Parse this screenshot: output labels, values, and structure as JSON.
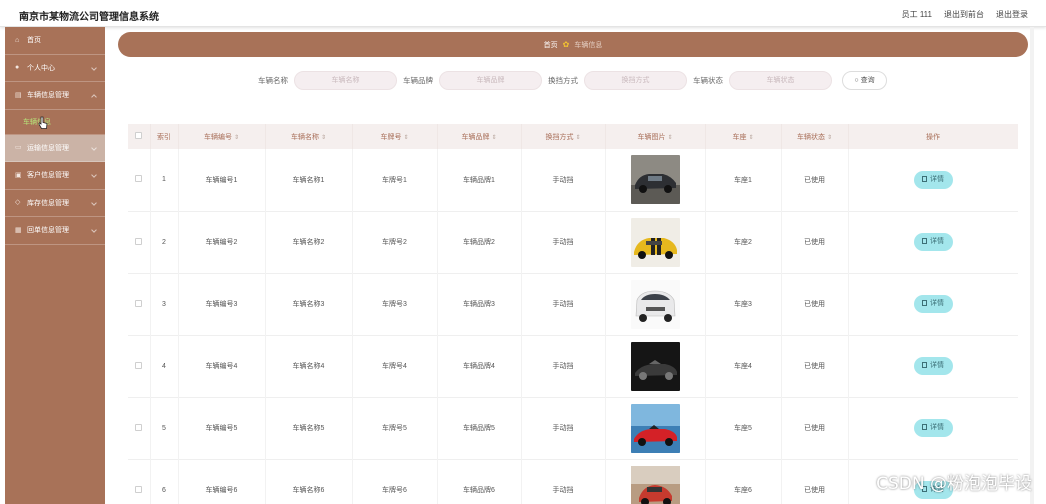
{
  "app": {
    "title": "南京市某物流公司管理信息系统"
  },
  "header": {
    "user": "员工 111",
    "back_front": "退出到前台",
    "logout": "退出登录"
  },
  "sidebar": {
    "items": [
      {
        "label": "首页",
        "icon": "home-icon"
      },
      {
        "label": "个人中心",
        "icon": "user-icon"
      },
      {
        "label": "车辆信息管理",
        "icon": "car-icon"
      },
      {
        "label": "车辆信息",
        "icon": ""
      },
      {
        "label": "运输信息管理",
        "icon": "truck-icon"
      },
      {
        "label": "客户信息管理",
        "icon": "customer-icon"
      },
      {
        "label": "库存信息管理",
        "icon": "warehouse-icon"
      },
      {
        "label": "回单信息管理",
        "icon": "receipt-icon"
      }
    ]
  },
  "breadcrumb": {
    "home": "首页",
    "current": "车辆信息"
  },
  "search": {
    "fields": [
      {
        "label": "车辆名称",
        "placeholder": "车辆名称"
      },
      {
        "label": "车辆品牌",
        "placeholder": "车辆品牌"
      },
      {
        "label": "换挡方式",
        "placeholder": "换挡方式"
      },
      {
        "label": "车辆状态",
        "placeholder": "车辆状态"
      }
    ],
    "button": "查询"
  },
  "table": {
    "columns": [
      "索引",
      "车辆编号",
      "车辆名称",
      "车牌号",
      "车辆品牌",
      "换挡方式",
      "车辆图片",
      "车座",
      "车辆状态",
      "操作"
    ],
    "detail_label": "详情",
    "rows": [
      {
        "index": "1",
        "code": "车辆编号1",
        "name": "车辆名称1",
        "plate": "车牌号1",
        "brand": "车辆品牌1",
        "gear": "手动挡",
        "seat": "车座1",
        "status": "已使用",
        "img": "dark-sports-car"
      },
      {
        "index": "2",
        "code": "车辆编号2",
        "name": "车辆名称2",
        "plate": "车牌号2",
        "brand": "车辆品牌2",
        "gear": "手动挡",
        "seat": "车座2",
        "status": "已使用",
        "img": "yellow-sports-car"
      },
      {
        "index": "3",
        "code": "车辆编号3",
        "name": "车辆名称3",
        "plate": "车牌号3",
        "brand": "车辆品牌3",
        "gear": "手动挡",
        "seat": "车座3",
        "status": "已使用",
        "img": "white-mpv"
      },
      {
        "index": "4",
        "code": "车辆编号4",
        "name": "车辆名称4",
        "plate": "车牌号4",
        "brand": "车辆品牌4",
        "gear": "手动挡",
        "seat": "车座4",
        "status": "已使用",
        "img": "black-convertible"
      },
      {
        "index": "5",
        "code": "车辆编号5",
        "name": "车辆名称5",
        "plate": "车牌号5",
        "brand": "车辆品牌5",
        "gear": "手动挡",
        "seat": "车座5",
        "status": "已使用",
        "img": "red-convertible"
      },
      {
        "index": "6",
        "code": "车辆编号6",
        "name": "车辆名称6",
        "plate": "车牌号6",
        "brand": "车辆品牌6",
        "gear": "手动挡",
        "seat": "车座6",
        "status": "已使用",
        "img": "rally-car"
      }
    ]
  },
  "watermark": "CSDN @粉泡泡毕设",
  "colors": {
    "sidebar": "#a87258",
    "accent_text": "#a86e58",
    "detail_button": "#a3e6ec",
    "submenu_active": "#b7e87a"
  }
}
